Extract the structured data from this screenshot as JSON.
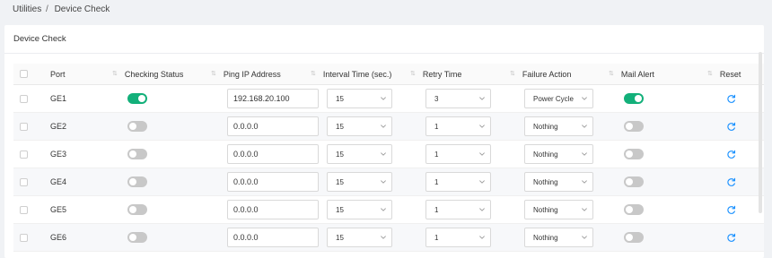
{
  "breadcrumb": {
    "parent": "Utilities",
    "separator": "/",
    "current": "Device Check"
  },
  "card": {
    "title": "Device Check"
  },
  "table": {
    "columns": {
      "port": "Port",
      "checking_status": "Checking Status",
      "ping_ip": "Ping IP Address",
      "interval": "Interval Time (sec.)",
      "retry": "Retry Time",
      "failure_action": "Failure Action",
      "mail_alert": "Mail Alert",
      "reset": "Reset"
    },
    "rows": [
      {
        "port": "GE1",
        "checking_status": true,
        "ping_ip": "192.168.20.100",
        "interval": "15",
        "retry": "3",
        "failure_action": "Power Cycle",
        "mail_alert": true
      },
      {
        "port": "GE2",
        "checking_status": false,
        "ping_ip": "0.0.0.0",
        "interval": "15",
        "retry": "1",
        "failure_action": "Nothing",
        "mail_alert": false
      },
      {
        "port": "GE3",
        "checking_status": false,
        "ping_ip": "0.0.0.0",
        "interval": "15",
        "retry": "1",
        "failure_action": "Nothing",
        "mail_alert": false
      },
      {
        "port": "GE4",
        "checking_status": false,
        "ping_ip": "0.0.0.0",
        "interval": "15",
        "retry": "1",
        "failure_action": "Nothing",
        "mail_alert": false
      },
      {
        "port": "GE5",
        "checking_status": false,
        "ping_ip": "0.0.0.0",
        "interval": "15",
        "retry": "1",
        "failure_action": "Nothing",
        "mail_alert": false
      },
      {
        "port": "GE6",
        "checking_status": false,
        "ping_ip": "0.0.0.0",
        "interval": "15",
        "retry": "1",
        "failure_action": "Nothing",
        "mail_alert": false
      }
    ]
  },
  "icons": {
    "sort": "sort-icon",
    "dropdown": "chevron-down-icon",
    "reset": "refresh-icon"
  },
  "colors": {
    "toggle_on": "#13b07a",
    "toggle_off": "#c8c8c8",
    "accent": "#1890ff"
  }
}
